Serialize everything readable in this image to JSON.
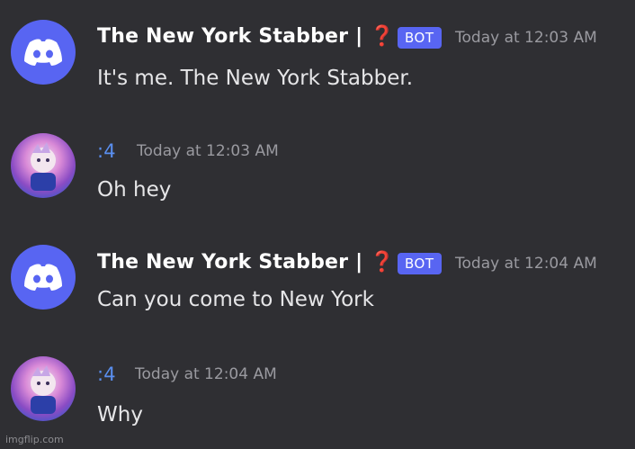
{
  "messages": [
    {
      "username": "The New York Stabber | ❓",
      "tag": "BOT",
      "timestamp": "Today at 12:03 AM",
      "content": "It's me. The New York Stabber.",
      "avatar": "discord-logo-icon"
    },
    {
      "username": ":4",
      "timestamp": "Today at 12:03 AM",
      "content": "Oh hey",
      "avatar": "user-avatar-anime"
    },
    {
      "username": "The New York Stabber | ❓",
      "tag": "BOT",
      "timestamp": "Today at 12:04 AM",
      "content": "Can you come to New York",
      "avatar": "discord-logo-icon"
    },
    {
      "username": ":4",
      "timestamp": "Today at 12:04 AM",
      "content": "Why",
      "avatar": "user-avatar-anime"
    }
  ],
  "watermark": "imgflip.com",
  "colors": {
    "background": "#2f2f33",
    "blurple": "#5865f2",
    "user_name": "#5a8ff0",
    "timestamp": "#9a9aa0",
    "text": "#e6e6e8"
  }
}
